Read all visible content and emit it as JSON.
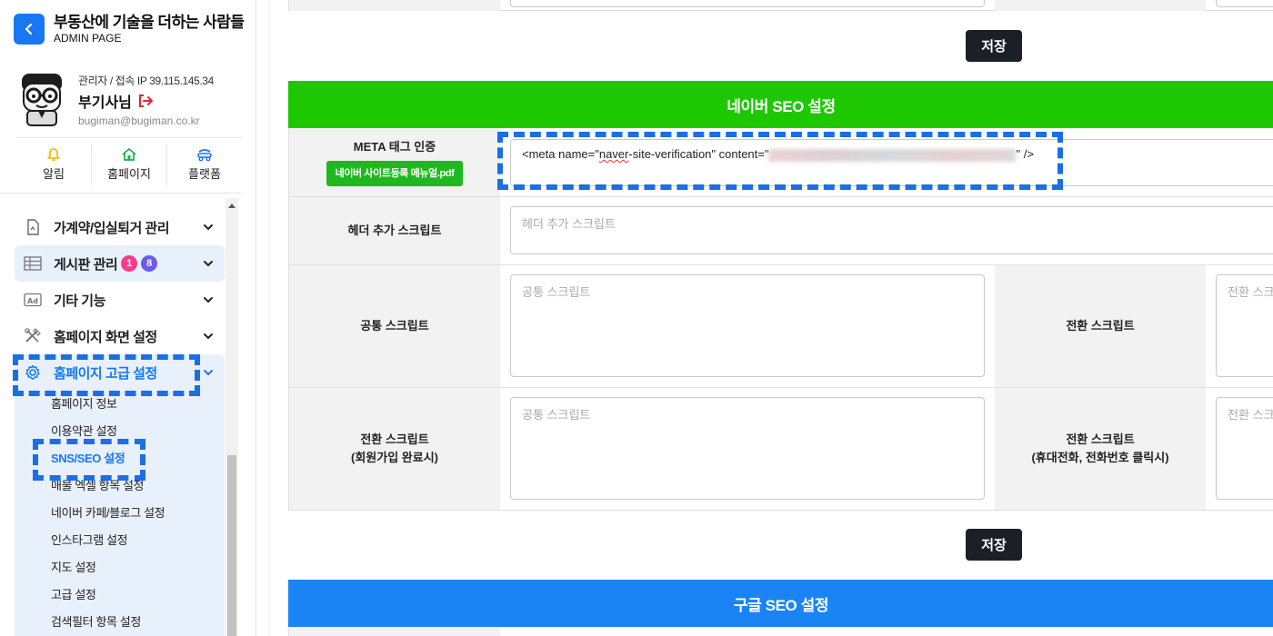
{
  "sidebar": {
    "brand_title": "부동산에 기술을 더하는 사람들",
    "brand_sub": "ADMIN PAGE",
    "profile": {
      "meta": "관리자 / 접속 IP 39.115.145.34",
      "name": "부기사님",
      "email": "bugiman@bugiman.co.kr"
    },
    "quick": [
      {
        "label": "알림",
        "icon": "bell-icon"
      },
      {
        "label": "홈페이지",
        "icon": "home-icon"
      },
      {
        "label": "플랫폼",
        "icon": "platform-icon"
      }
    ],
    "menu": [
      {
        "label": "가계약/입실퇴거 관리",
        "icon": "document-icon"
      },
      {
        "label": "게시판 관리",
        "icon": "board-icon",
        "badges": [
          "1",
          "8"
        ]
      },
      {
        "label": "기타 기능",
        "icon": "ad-icon"
      },
      {
        "label": "홈페이지 화면 설정",
        "icon": "tools-icon"
      },
      {
        "label": "홈페이지 고급 설정",
        "icon": "gear-icon"
      }
    ],
    "submenu": [
      "홈페이지 정보",
      "이용약관 설정",
      "SNS/SEO 설정",
      "매물 엑셀 항목 설정",
      "네이버 카페/블로그 설정",
      "인스타그램 설정",
      "지도 설정",
      "고급 설정",
      "검색필터 항목 설정"
    ]
  },
  "main": {
    "save_label": "저장",
    "naver_section_title": "네이버 SEO 설정",
    "google_section_title": "구글 SEO 설정",
    "meta_label": "META 태그 인증",
    "pdf_button": "네이버 사이트등록 메뉴얼.pdf",
    "meta_value_prefix": "<meta name=\"",
    "meta_value_word": "naver",
    "meta_value_mid": "-site-verification\" content=\"",
    "meta_value_suffix": "\" />",
    "header_script_label": "헤더 추가 스크립트",
    "header_script_placeholder": "헤더 추가 스크립트",
    "common_script_label": "공통 스크립트",
    "common_script_placeholder": "공통 스크립트",
    "conversion_label": "전환 스크립트",
    "conversion_placeholder": "전환 스크립트",
    "conversion_signup_label_1": "전환 스크립트",
    "conversion_signup_label_2": "(회원가입 완료시)",
    "conversion_phone_label_1": "전환 스크립트",
    "conversion_phone_label_2": "(휴대전화, 전화번호 클릭시)",
    "row4_placeholder": "공통 스크립트",
    "row4_right_placeholder": "전환 스크립트"
  },
  "colors": {
    "accent_blue": "#1877f2",
    "naver_green": "#1ec800",
    "google_blue": "#1a84f5",
    "dark_button": "#1b2027",
    "pdf_green": "#1fb91f"
  }
}
